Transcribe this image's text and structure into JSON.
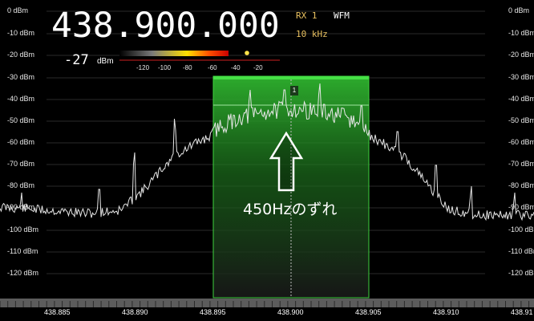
{
  "receiver": {
    "frequency": "438.900.000",
    "rx_label": "RX 1",
    "mode": "WFM",
    "bandwidth": "10 kHz",
    "signal_level": "-27",
    "signal_level_unit": "dBm",
    "meter_scale": [
      "-120",
      "-100",
      "-80",
      "-60",
      "-40",
      "-20"
    ],
    "passband_label": "1"
  },
  "spectrum": {
    "db_scale_left": [
      "0 dBm",
      "-10 dBm",
      "-20 dBm",
      "-30 dBm",
      "-40 dBm",
      "-50 dBm",
      "-60 dBm",
      "-70 dBm",
      "-80 dBm",
      "-90 dBm",
      "-100 dBm",
      "-110 dBm",
      "-120 dBm"
    ],
    "db_scale_right": [
      "0 dBm",
      "-10 dBm",
      "-20 dBm",
      "-30 dBm",
      "-40 dBm",
      "-50 dBm",
      "-60 dBm",
      "-70 dBm",
      "-80 dBm",
      "-90 dBm",
      "-100 dBm",
      "-110 dBm",
      "-120 dBm"
    ],
    "freq_scale": [
      "438.885",
      "438.890",
      "438.895",
      "438.900",
      "438.905",
      "438.910",
      "438.91"
    ],
    "passband_mhz": [
      438.8953,
      438.9052
    ],
    "center_mhz": 438.9
  },
  "annotation": {
    "text": "450Hzのずれ"
  },
  "colors": {
    "passband": "#2fb52f",
    "trace": "#e6e6e6",
    "readout_accent": "#e8c060"
  }
}
